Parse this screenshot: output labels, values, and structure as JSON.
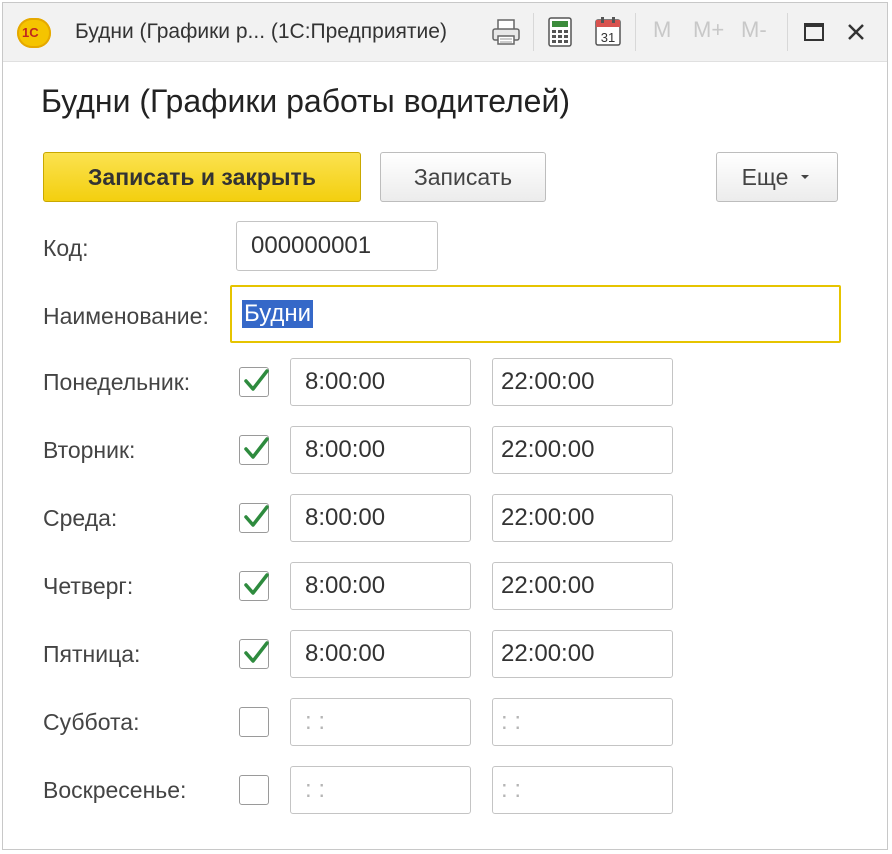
{
  "window": {
    "title": "Будни (Графики р...  (1С:Предприятие)",
    "logo_text": "1С",
    "m_buttons": [
      "M",
      "M+",
      "M-"
    ],
    "calendar_day": "31"
  },
  "form": {
    "heading": "Будни (Графики работы водителей)",
    "save_close_label": "Записать и закрыть",
    "save_label": "Записать",
    "more_label": "Еще",
    "code_label": "Код:",
    "code_value": "000000001",
    "name_label": "Наименование:",
    "name_value": "Будни"
  },
  "days": [
    {
      "label": "Понедельник:",
      "checked": true,
      "start": "8:00:00",
      "end": "22:00:00"
    },
    {
      "label": "Вторник:",
      "checked": true,
      "start": "8:00:00",
      "end": "22:00:00"
    },
    {
      "label": "Среда:",
      "checked": true,
      "start": "8:00:00",
      "end": "22:00:00"
    },
    {
      "label": "Четверг:",
      "checked": true,
      "start": "8:00:00",
      "end": "22:00:00"
    },
    {
      "label": "Пятница:",
      "checked": true,
      "start": "8:00:00",
      "end": "22:00:00"
    },
    {
      "label": "Суббота:",
      "checked": false,
      "start": " :  :",
      "end": " :  :"
    },
    {
      "label": "Воскресенье:",
      "checked": false,
      "start": " :  :",
      "end": " :  :"
    }
  ],
  "colors": {
    "primary_button": "#f3cf0f",
    "focus_border": "#e6c400",
    "checkmark": "#2e8b3e",
    "selection": "#3568c8"
  }
}
